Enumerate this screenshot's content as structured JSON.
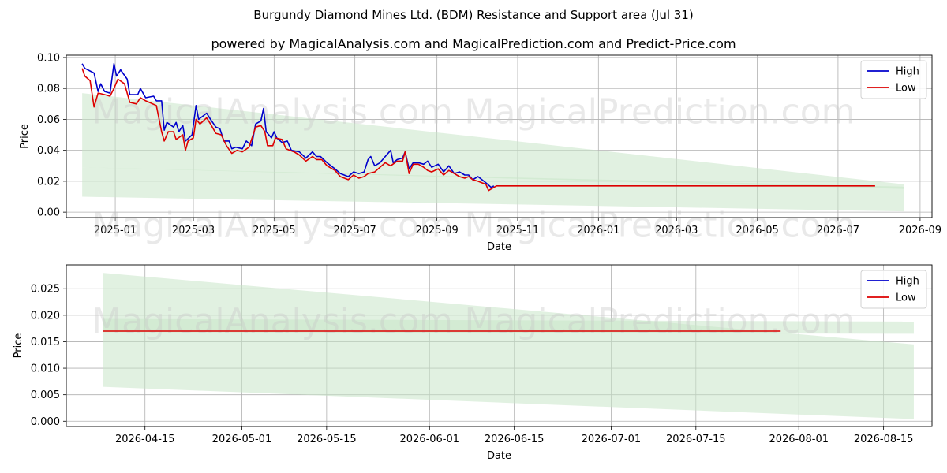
{
  "title": "Burgundy Diamond Mines Ltd. (BDM) Resistance and Support area (Jul 31)",
  "subtitle": "powered by MagicalAnalysis.com and MagicalPrediction.com and Predict-Price.com",
  "watermarks": [
    "MagicalAnalysis.com",
    "MagicalPrediction.com"
  ],
  "colors": {
    "high": "#0000cc",
    "low": "#dd0000",
    "band": "#c8e6c8",
    "grid": "#b0b0b0"
  },
  "chart_data": [
    {
      "type": "line",
      "xlabel": "Date",
      "ylabel": "Price",
      "x_range": [
        "2024-11-25",
        "2026-09-10"
      ],
      "ylim": [
        -0.0035,
        0.1015
      ],
      "x_ticks": [
        "2025-01",
        "2025-03",
        "2025-05",
        "2025-07",
        "2025-09",
        "2025-11",
        "2026-01",
        "2026-03",
        "2026-05",
        "2026-07",
        "2026-09"
      ],
      "y_ticks": [
        "0.00",
        "0.02",
        "0.04",
        "0.06",
        "0.08",
        "0.10"
      ],
      "legend": {
        "position": "top-right",
        "entries": [
          "High",
          "Low"
        ]
      },
      "grid": true,
      "bands": [
        {
          "x": [
            "2024-12-07",
            "2026-08-20"
          ],
          "upper": [
            0.077,
            0.018
          ],
          "lower": [
            0.029,
            0.015
          ]
        },
        {
          "x": [
            "2024-12-07",
            "2026-08-20"
          ],
          "upper": [
            0.029,
            0.0165
          ],
          "lower": [
            0.01,
            0.0005
          ]
        }
      ],
      "series": [
        {
          "name": "High",
          "points": [
            [
              "2024-12-07",
              0.096
            ],
            [
              "2024-12-09",
              0.093
            ],
            [
              "2024-12-16",
              0.09
            ],
            [
              "2024-12-19",
              0.078
            ],
            [
              "2024-12-21",
              0.083
            ],
            [
              "2024-12-24",
              0.078
            ],
            [
              "2024-12-28",
              0.077
            ],
            [
              "2024-12-31",
              0.096
            ],
            [
              "2025-01-02",
              0.088
            ],
            [
              "2025-01-05",
              0.092
            ],
            [
              "2025-01-10",
              0.086
            ],
            [
              "2025-01-12",
              0.076
            ],
            [
              "2025-01-18",
              0.076
            ],
            [
              "2025-01-20",
              0.08
            ],
            [
              "2025-01-24",
              0.074
            ],
            [
              "2025-01-30",
              0.075
            ],
            [
              "2025-02-01",
              0.072
            ],
            [
              "2025-02-05",
              0.072
            ],
            [
              "2025-02-07",
              0.053
            ],
            [
              "2025-02-09",
              0.058
            ],
            [
              "2025-02-14",
              0.055
            ],
            [
              "2025-02-16",
              0.058
            ],
            [
              "2025-02-18",
              0.052
            ],
            [
              "2025-02-21",
              0.056
            ],
            [
              "2025-02-23",
              0.046
            ],
            [
              "2025-02-28",
              0.05
            ],
            [
              "2025-03-03",
              0.069
            ],
            [
              "2025-03-05",
              0.06
            ],
            [
              "2025-03-11",
              0.064
            ],
            [
              "2025-03-14",
              0.06
            ],
            [
              "2025-03-18",
              0.055
            ],
            [
              "2025-03-21",
              0.054
            ],
            [
              "2025-03-24",
              0.046
            ],
            [
              "2025-03-28",
              0.046
            ],
            [
              "2025-03-30",
              0.041
            ],
            [
              "2025-04-02",
              0.042
            ],
            [
              "2025-04-07",
              0.041
            ],
            [
              "2025-04-10",
              0.046
            ],
            [
              "2025-04-14",
              0.043
            ],
            [
              "2025-04-17",
              0.057
            ],
            [
              "2025-04-21",
              0.059
            ],
            [
              "2025-04-23",
              0.067
            ],
            [
              "2025-04-25",
              0.052
            ],
            [
              "2025-04-29",
              0.048
            ],
            [
              "2025-05-01",
              0.052
            ],
            [
              "2025-05-03",
              0.048
            ],
            [
              "2025-05-07",
              0.045
            ],
            [
              "2025-05-11",
              0.046
            ],
            [
              "2025-05-14",
              0.04
            ],
            [
              "2025-05-20",
              0.039
            ],
            [
              "2025-05-25",
              0.035
            ],
            [
              "2025-05-30",
              0.039
            ],
            [
              "2025-06-02",
              0.036
            ],
            [
              "2025-06-05",
              0.036
            ],
            [
              "2025-06-10",
              0.032
            ],
            [
              "2025-06-16",
              0.028
            ],
            [
              "2025-06-20",
              0.025
            ],
            [
              "2025-06-26",
              0.023
            ],
            [
              "2025-06-30",
              0.026
            ],
            [
              "2025-07-04",
              0.025
            ],
            [
              "2025-07-08",
              0.026
            ],
            [
              "2025-07-11",
              0.034
            ],
            [
              "2025-07-13",
              0.036
            ],
            [
              "2025-07-16",
              0.03
            ],
            [
              "2025-07-20",
              0.032
            ],
            [
              "2025-07-24",
              0.036
            ],
            [
              "2025-07-28",
              0.04
            ],
            [
              "2025-07-30",
              0.032
            ],
            [
              "2025-08-02",
              0.034
            ],
            [
              "2025-08-06",
              0.035
            ],
            [
              "2025-08-08",
              0.039
            ],
            [
              "2025-08-11",
              0.028
            ],
            [
              "2025-08-14",
              0.032
            ],
            [
              "2025-08-18",
              0.032
            ],
            [
              "2025-08-22",
              0.031
            ],
            [
              "2025-08-25",
              0.033
            ],
            [
              "2025-08-28",
              0.029
            ],
            [
              "2025-09-02",
              0.031
            ],
            [
              "2025-09-06",
              0.026
            ],
            [
              "2025-09-10",
              0.03
            ],
            [
              "2025-09-14",
              0.025
            ],
            [
              "2025-09-18",
              0.026
            ],
            [
              "2025-09-22",
              0.024
            ],
            [
              "2025-09-25",
              0.024
            ],
            [
              "2025-09-28",
              0.021
            ],
            [
              "2025-10-02",
              0.023
            ],
            [
              "2025-10-05",
              0.021
            ],
            [
              "2025-10-08",
              0.019
            ],
            [
              "2025-10-12",
              0.016
            ],
            [
              "2025-10-14",
              0.017
            ]
          ]
        },
        {
          "name": "Low",
          "points": [
            [
              "2024-12-07",
              0.093
            ],
            [
              "2024-12-09",
              0.088
            ],
            [
              "2024-12-13",
              0.085
            ],
            [
              "2024-12-16",
              0.068
            ],
            [
              "2024-12-19",
              0.077
            ],
            [
              "2024-12-24",
              0.076
            ],
            [
              "2024-12-28",
              0.075
            ],
            [
              "2024-12-31",
              0.08
            ],
            [
              "2025-01-03",
              0.086
            ],
            [
              "2025-01-08",
              0.083
            ],
            [
              "2025-01-12",
              0.071
            ],
            [
              "2025-01-17",
              0.07
            ],
            [
              "2025-01-20",
              0.074
            ],
            [
              "2025-01-24",
              0.072
            ],
            [
              "2025-02-01",
              0.069
            ],
            [
              "2025-02-05",
              0.052
            ],
            [
              "2025-02-07",
              0.046
            ],
            [
              "2025-02-10",
              0.052
            ],
            [
              "2025-02-14",
              0.052
            ],
            [
              "2025-02-16",
              0.047
            ],
            [
              "2025-02-21",
              0.05
            ],
            [
              "2025-02-23",
              0.04
            ],
            [
              "2025-02-25",
              0.046
            ],
            [
              "2025-03-01",
              0.048
            ],
            [
              "2025-03-03",
              0.06
            ],
            [
              "2025-03-06",
              0.057
            ],
            [
              "2025-03-11",
              0.061
            ],
            [
              "2025-03-14",
              0.057
            ],
            [
              "2025-03-18",
              0.051
            ],
            [
              "2025-03-22",
              0.05
            ],
            [
              "2025-03-26",
              0.043
            ],
            [
              "2025-03-30",
              0.038
            ],
            [
              "2025-04-03",
              0.04
            ],
            [
              "2025-04-07",
              0.039
            ],
            [
              "2025-04-12",
              0.042
            ],
            [
              "2025-04-17",
              0.055
            ],
            [
              "2025-04-21",
              0.056
            ],
            [
              "2025-04-24",
              0.052
            ],
            [
              "2025-04-26",
              0.043
            ],
            [
              "2025-04-30",
              0.043
            ],
            [
              "2025-05-02",
              0.048
            ],
            [
              "2025-05-07",
              0.047
            ],
            [
              "2025-05-10",
              0.041
            ],
            [
              "2025-05-16",
              0.039
            ],
            [
              "2025-05-20",
              0.037
            ],
            [
              "2025-05-25",
              0.033
            ],
            [
              "2025-05-30",
              0.036
            ],
            [
              "2025-06-02",
              0.034
            ],
            [
              "2025-06-06",
              0.034
            ],
            [
              "2025-06-10",
              0.03
            ],
            [
              "2025-06-16",
              0.027
            ],
            [
              "2025-06-20",
              0.023
            ],
            [
              "2025-06-26",
              0.021
            ],
            [
              "2025-06-30",
              0.024
            ],
            [
              "2025-07-04",
              0.022
            ],
            [
              "2025-07-08",
              0.023
            ],
            [
              "2025-07-11",
              0.025
            ],
            [
              "2025-07-16",
              0.026
            ],
            [
              "2025-07-20",
              0.029
            ],
            [
              "2025-07-24",
              0.032
            ],
            [
              "2025-07-28",
              0.03
            ],
            [
              "2025-08-02",
              0.033
            ],
            [
              "2025-08-06",
              0.033
            ],
            [
              "2025-08-08",
              0.039
            ],
            [
              "2025-08-11",
              0.025
            ],
            [
              "2025-08-14",
              0.031
            ],
            [
              "2025-08-18",
              0.031
            ],
            [
              "2025-08-22",
              0.029
            ],
            [
              "2025-08-25",
              0.027
            ],
            [
              "2025-08-28",
              0.026
            ],
            [
              "2025-09-02",
              0.028
            ],
            [
              "2025-09-06",
              0.024
            ],
            [
              "2025-09-10",
              0.027
            ],
            [
              "2025-09-14",
              0.025
            ],
            [
              "2025-09-18",
              0.023
            ],
            [
              "2025-09-22",
              0.022
            ],
            [
              "2025-09-25",
              0.023
            ],
            [
              "2025-09-28",
              0.021
            ],
            [
              "2025-10-02",
              0.02
            ],
            [
              "2025-10-05",
              0.019
            ],
            [
              "2025-10-08",
              0.018
            ],
            [
              "2025-10-10",
              0.014
            ],
            [
              "2025-10-14",
              0.016
            ],
            [
              "2025-10-16",
              0.017
            ],
            [
              "2026-07-29",
              0.017
            ]
          ]
        }
      ]
    },
    {
      "type": "line",
      "xlabel": "Date",
      "ylabel": "Price",
      "x_range": [
        "2026-04-02",
        "2026-08-23"
      ],
      "ylim": [
        -0.001,
        0.0295
      ],
      "x_ticks": [
        "2026-04-15",
        "2026-05-01",
        "2026-05-15",
        "2026-06-01",
        "2026-06-15",
        "2026-07-01",
        "2026-07-15",
        "2026-08-01",
        "2026-08-15"
      ],
      "y_ticks": [
        "0.000",
        "0.005",
        "0.010",
        "0.015",
        "0.020",
        "0.025"
      ],
      "legend": {
        "position": "top-right",
        "entries": [
          "High",
          "Low"
        ]
      },
      "grid": true,
      "bands": [
        {
          "x": [
            "2026-04-08",
            "2026-08-20"
          ],
          "upper": [
            0.0193,
            0.0188
          ],
          "lower": [
            0.0168,
            0.0165
          ]
        },
        {
          "x": [
            "2026-04-08",
            "2026-08-20"
          ],
          "upper": [
            0.028,
            0.0145
          ],
          "lower": [
            0.0065,
            0.0004
          ]
        }
      ],
      "series": [
        {
          "name": "High",
          "points": []
        },
        {
          "name": "Low",
          "points": [
            [
              "2026-04-08",
              0.017
            ],
            [
              "2026-07-29",
              0.017
            ]
          ]
        }
      ]
    }
  ]
}
